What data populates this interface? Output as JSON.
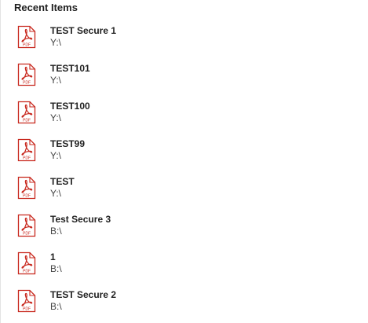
{
  "panel": {
    "title": "Recent Items"
  },
  "icon": {
    "name": "pdf-file-icon",
    "badge_text": "PDF",
    "accent_color": "#c8281e"
  },
  "items": [
    {
      "name": "TEST Secure 1",
      "path": "Y:\\"
    },
    {
      "name": "TEST101",
      "path": "Y:\\"
    },
    {
      "name": "TEST100",
      "path": "Y:\\"
    },
    {
      "name": "TEST99",
      "path": "Y:\\"
    },
    {
      "name": "TEST",
      "path": "Y:\\"
    },
    {
      "name": "Test Secure 3",
      "path": "B:\\"
    },
    {
      "name": "1",
      "path": "B:\\"
    },
    {
      "name": "TEST Secure 2",
      "path": "B:\\"
    }
  ]
}
